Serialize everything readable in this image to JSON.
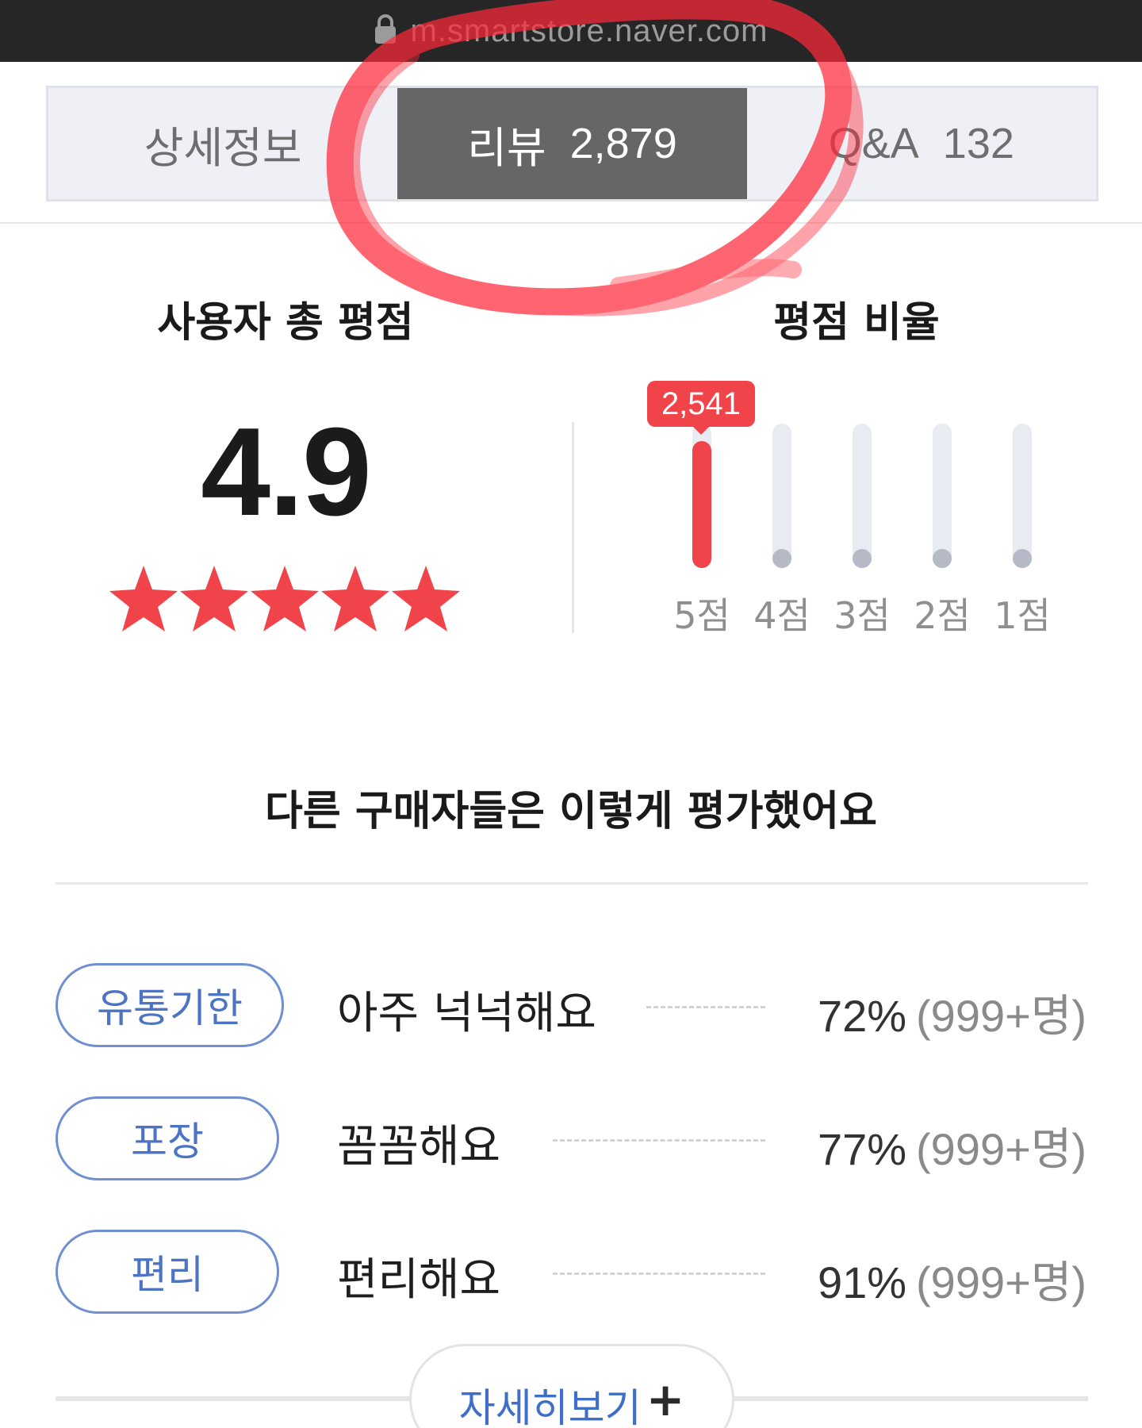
{
  "browser": {
    "url": "m.smartstore.naver.com"
  },
  "tabs": [
    {
      "label": "상세정보",
      "count": "",
      "active": false
    },
    {
      "label": "리뷰",
      "count": "2,879",
      "active": true
    },
    {
      "label": "Q&A",
      "count": "132",
      "active": false
    }
  ],
  "summary": {
    "total_title": "사용자 총 평점",
    "ratio_title": "평점 비율",
    "score": "4.9",
    "stars_filled": 5,
    "stars_max": 5
  },
  "rating_ratio": {
    "badge": "2,541",
    "bars": [
      {
        "label": "5점",
        "fraction": 0.88
      },
      {
        "label": "4점",
        "fraction": 0.0
      },
      {
        "label": "3점",
        "fraction": 0.0
      },
      {
        "label": "2점",
        "fraction": 0.0
      },
      {
        "label": "1점",
        "fraction": 0.0
      }
    ]
  },
  "evaluation": {
    "title": "다른 구매자들은 이렇게 평가했어요",
    "items": [
      {
        "tag": "유통기한",
        "text": "아주 넉넉해요",
        "percent": "72%",
        "count": "(999+명)"
      },
      {
        "tag": "포장",
        "text": "꼼꼼해요",
        "percent": "77%",
        "count": "(999+명)"
      },
      {
        "tag": "편리",
        "text": "편리해요",
        "percent": "91%",
        "count": "(999+명)"
      }
    ],
    "more_label": "자세히보기",
    "more_icon": "+"
  },
  "colors": {
    "accent_red": "#f0444a",
    "tag_blue": "#4d74c4",
    "active_tab": "#666666",
    "annotation": "#ff2a3a"
  }
}
